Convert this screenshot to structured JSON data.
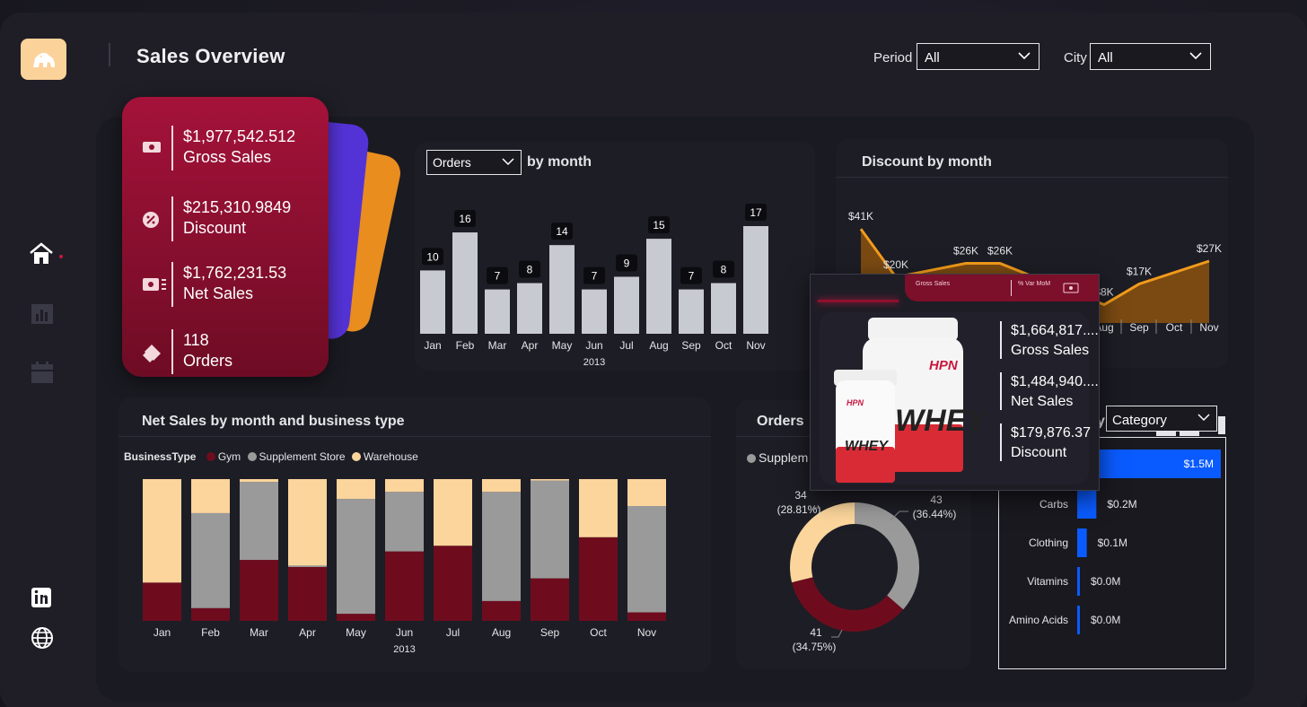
{
  "header": {
    "title": "Sales Overview",
    "period_label": "Period",
    "period_value": "All",
    "city_label": "City",
    "city_value": "All"
  },
  "nav": {
    "items": [
      "home-icon",
      "chart-icon",
      "calendar-icon",
      "linkedin-icon",
      "globe-icon"
    ]
  },
  "kpis": {
    "gross_sales_value": "$1,977,542.512",
    "gross_sales_label": "Gross Sales",
    "discount_value": "$215,310.9849",
    "discount_label": "Discount",
    "net_sales_value": "$1,762,231.53",
    "net_sales_label": "Net Sales",
    "orders_value": "118",
    "orders_label": "Orders"
  },
  "orders_chart": {
    "selector_value": "Orders",
    "title_suffix": "by month"
  },
  "discount_chart": {
    "title": "Discount by month"
  },
  "net_sales_chart": {
    "title": "Net Sales by month and business type",
    "legend_title": "BusinessType",
    "legend": [
      "Gym",
      "Supplement Store",
      "Warehouse"
    ]
  },
  "donut_chart": {
    "title": "Orders",
    "legend_partial": "Supplem"
  },
  "category_chart": {
    "title_partial": "y",
    "selector_value": "Category"
  },
  "popup": {
    "header_left": "Gross Sales",
    "header_right": "% Var MoM",
    "gross_sales_value": "$1,664,817....",
    "gross_sales_label": "Gross Sales",
    "net_sales_value": "$1,484,940....",
    "net_sales_label": "Net Sales",
    "discount_value": "$179,876.37",
    "discount_label": "Discount",
    "product_brand": "HPN",
    "product_name": "WHEY"
  },
  "colors": {
    "accent_red": "#a5123a",
    "gym": "#6e0c1e",
    "supplement_store": "#9a9a9a",
    "warehouse": "#fbd59c",
    "bar_gray": "#c8cad2",
    "discount_orange": "#f29b1b",
    "category_blue": "#0a5bff"
  },
  "chart_data": [
    {
      "type": "bar",
      "title": "Orders by month",
      "categories": [
        "Jan",
        "Feb",
        "Mar",
        "Apr",
        "May",
        "Jun",
        "Jul",
        "Aug",
        "Sep",
        "Oct",
        "Nov"
      ],
      "values": [
        10,
        16,
        7,
        8,
        14,
        7,
        9,
        15,
        7,
        8,
        17
      ],
      "xlabel": "2013",
      "ylim": [
        0,
        17
      ]
    },
    {
      "type": "area",
      "title": "Discount by month",
      "visible_categories": [
        "Aug",
        "Sep",
        "Oct",
        "Nov"
      ],
      "points": [
        {
          "label": "$41K",
          "value": 41
        },
        {
          "label": "$20K",
          "value": 20
        },
        {
          "label": "$26K",
          "value": 26
        },
        {
          "label": "$26K",
          "value": 26
        },
        {
          "label": "$8K",
          "value": 8
        },
        {
          "label": "$17K",
          "value": 17
        },
        {
          "label": "$27K",
          "value": 27
        }
      ]
    },
    {
      "type": "bar",
      "stacked": true,
      "percent": true,
      "title": "Net Sales by month and business type",
      "categories": [
        "Jan",
        "Feb",
        "Mar",
        "Apr",
        "May",
        "Jun",
        "Jul",
        "Aug",
        "Sep",
        "Oct",
        "Nov"
      ],
      "xlabel": "2013",
      "series": [
        {
          "name": "Gym",
          "values": [
            27,
            9,
            43,
            38,
            5,
            49,
            53,
            14,
            30,
            59,
            6
          ]
        },
        {
          "name": "Supplement Store",
          "values": [
            0,
            67,
            55,
            1,
            81,
            42,
            0,
            77,
            69,
            0,
            75
          ]
        },
        {
          "name": "Warehouse",
          "values": [
            73,
            24,
            2,
            61,
            14,
            9,
            47,
            9,
            1,
            41,
            19
          ]
        }
      ]
    },
    {
      "type": "pie",
      "donut": true,
      "title": "Orders",
      "slices": [
        {
          "value": 43,
          "label": "43",
          "pct": "(36.44%)"
        },
        {
          "value": 41,
          "label": "41",
          "pct": "(34.75%)"
        },
        {
          "value": 34,
          "label": "34",
          "pct": "(28.81%)"
        }
      ]
    },
    {
      "type": "bar",
      "orientation": "horizontal",
      "title": "Net Sales by Category",
      "categories": [
        "",
        "Carbs",
        "Clothing",
        "Vitamins",
        "Amino Acids"
      ],
      "values": [
        1.5,
        0.2,
        0.1,
        0.0,
        0.0
      ],
      "labels": [
        "$1.5M",
        "$0.2M",
        "$0.1M",
        "$0.0M",
        "$0.0M"
      ]
    }
  ]
}
